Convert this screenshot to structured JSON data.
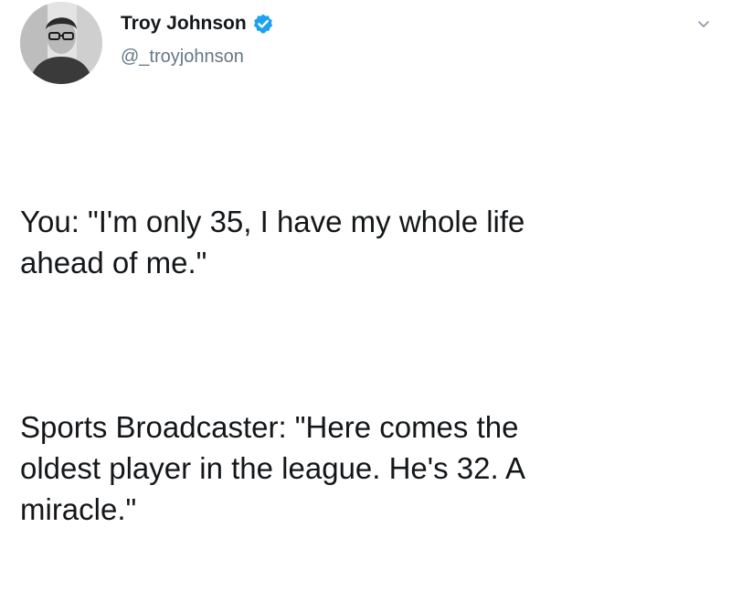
{
  "user": {
    "display_name": "Troy Johnson",
    "handle": "@_troyjohnson",
    "verified": true,
    "avatar_icon": "user-avatar",
    "verified_icon": "verified-badge-icon",
    "verified_color": "#1da1f2"
  },
  "tweet": {
    "paragraphs": [
      "You: \"I'm only 35, I have my whole life\nahead of me.\"",
      "Sports Broadcaster: \"Here comes the\noldest player in the league. He's 32. A\nmiracle.\""
    ]
  },
  "menu": {
    "caret_icon": "chevron-down-icon"
  }
}
